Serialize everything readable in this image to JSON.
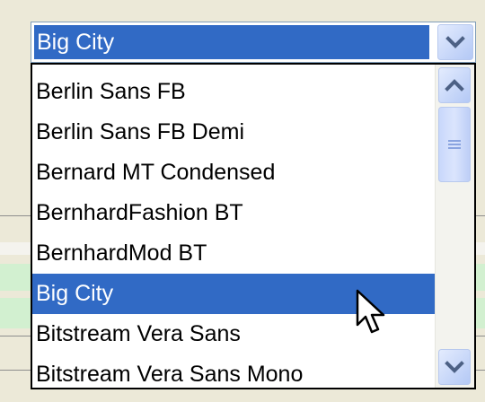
{
  "combo": {
    "selected_value": "Big City",
    "dropdown_icon": "chevron-down-icon"
  },
  "list": {
    "items": [
      {
        "label": "Berlin Sans FB"
      },
      {
        "label": "Berlin Sans FB Demi"
      },
      {
        "label": "Bernard MT Condensed"
      },
      {
        "label": "BernhardFashion BT"
      },
      {
        "label": "BernhardMod BT"
      },
      {
        "label": "Big City",
        "selected": true
      },
      {
        "label": "Bitstream Vera Sans"
      },
      {
        "label": "Bitstream Vera Sans Mono"
      }
    ]
  },
  "scrollbar": {
    "up_icon": "chevron-up-icon",
    "down_icon": "chevron-down-icon",
    "thumb_icon": "grip-icon"
  },
  "colors": {
    "selection": "#316ac5",
    "window_bg": "#ece9d8",
    "button_face": "#c1d3fb",
    "arrow": "#4d6185"
  }
}
